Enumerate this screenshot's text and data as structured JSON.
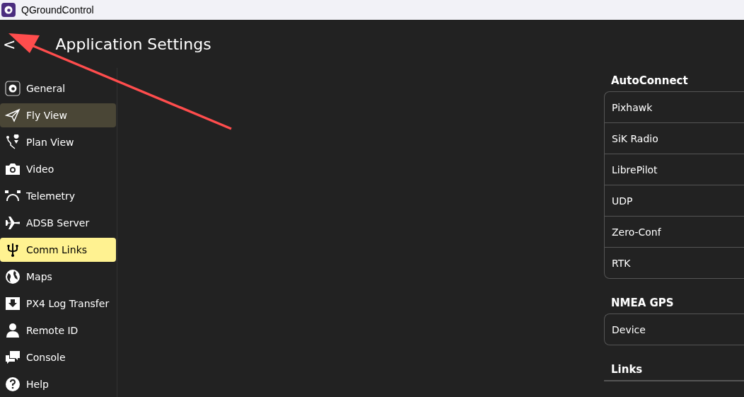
{
  "window": {
    "title": "QGroundControl"
  },
  "header": {
    "back": "<",
    "title": "Application Settings"
  },
  "sidebar": {
    "items": [
      {
        "label": "General",
        "selected": false,
        "hovered": false
      },
      {
        "label": "Fly View",
        "selected": false,
        "hovered": true
      },
      {
        "label": "Plan View",
        "selected": false,
        "hovered": false
      },
      {
        "label": "Video",
        "selected": false,
        "hovered": false
      },
      {
        "label": "Telemetry",
        "selected": false,
        "hovered": false
      },
      {
        "label": "ADSB Server",
        "selected": false,
        "hovered": false
      },
      {
        "label": "Comm Links",
        "selected": true,
        "hovered": false
      },
      {
        "label": "Maps",
        "selected": false,
        "hovered": false
      },
      {
        "label": "PX4 Log Transfer",
        "selected": false,
        "hovered": false
      },
      {
        "label": "Remote ID",
        "selected": false,
        "hovered": false
      },
      {
        "label": "Console",
        "selected": false,
        "hovered": false
      },
      {
        "label": "Help",
        "selected": false,
        "hovered": false
      }
    ]
  },
  "sections": [
    {
      "title": "AutoConnect",
      "rows": [
        "Pixhawk",
        "SiK Radio",
        "LibrePilot",
        "UDP",
        "Zero-Conf",
        "RTK"
      ]
    },
    {
      "title": "NMEA GPS",
      "rows": [
        "Device"
      ]
    },
    {
      "title": "Links"
    }
  ]
}
